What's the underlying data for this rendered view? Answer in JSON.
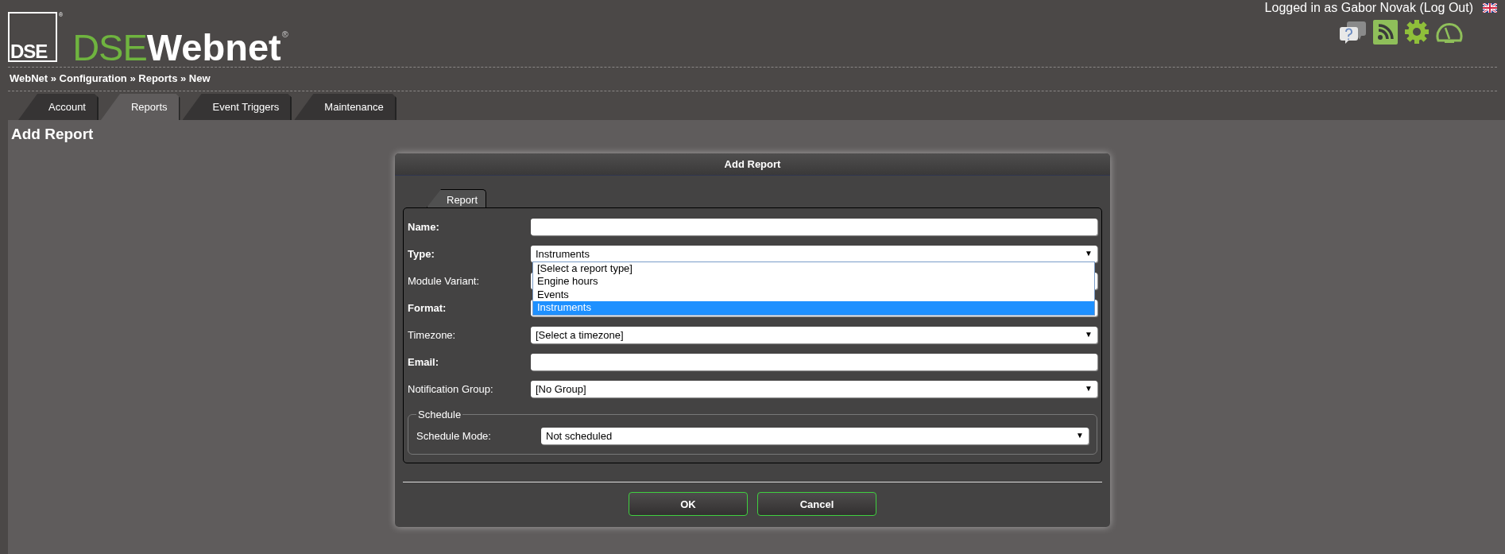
{
  "logo": {
    "mark": "DSE",
    "mark_registered": "®",
    "brand_light": "DSE",
    "brand_bold": "Webnet",
    "brand_registered": "®"
  },
  "login": {
    "prefix": "Logged in as Gabor Novak (",
    "link": "Log Out",
    "suffix": ")"
  },
  "breadcrumb": "WebNet » Configuration » Reports » New",
  "tabs": [
    {
      "label": "Account",
      "selected": false
    },
    {
      "label": "Reports",
      "selected": true
    },
    {
      "label": "Event Triggers",
      "selected": false
    },
    {
      "label": "Maintenance",
      "selected": false
    }
  ],
  "page_title": "Add Report",
  "dialog": {
    "title": "Add Report",
    "tabs": [
      {
        "label": "Report",
        "selected": true
      }
    ],
    "fields": [
      {
        "label": "Name:",
        "required": true,
        "kind": "text"
      },
      {
        "label": "Type:",
        "required": true,
        "kind": "select",
        "value": "Instruments",
        "open": true,
        "options": [
          {
            "label": "[Select a report type]",
            "selected": false
          },
          {
            "label": "Engine hours",
            "selected": false
          },
          {
            "label": "Events",
            "selected": false
          },
          {
            "label": "Instruments",
            "selected": true
          }
        ]
      },
      {
        "label": "Module Variant:",
        "required": false,
        "kind": "text"
      },
      {
        "label": "Format:",
        "required": true,
        "kind": "text"
      },
      {
        "label": "Timezone:",
        "required": false,
        "kind": "select",
        "value": "[Select a timezone]",
        "open": false
      },
      {
        "label": "Email:",
        "required": true,
        "kind": "text"
      },
      {
        "label": "Notification Group:",
        "required": false,
        "kind": "select",
        "value": "[No Group]",
        "open": false
      }
    ],
    "schedule": {
      "legend": "Schedule",
      "label": "Schedule Mode:",
      "value": "Not scheduled",
      "arrow": "▼"
    },
    "buttons": [
      "OK",
      "Cancel"
    ]
  }
}
